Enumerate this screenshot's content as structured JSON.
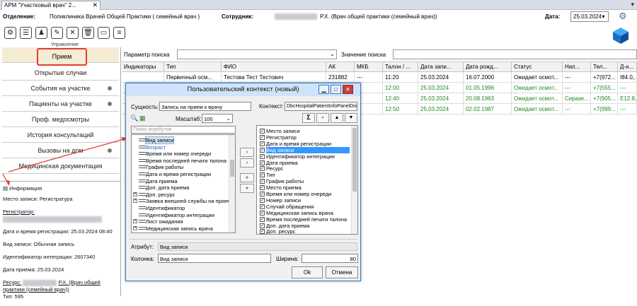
{
  "window": {
    "tab_title": "АРМ \"Участковый врач\" 2...",
    "tab_close": "✕",
    "tab_arrow": "▾"
  },
  "header": {
    "dept_label": "Отделение:",
    "dept_value": "Поликлиника Врачей Общей Практики ( семейный врач )",
    "employee_label": "Сотрудник:",
    "employee_value": "Р.Х. (Врач общей практики (семейный врач))",
    "date_label": "Дата:",
    "date_value": "25.03.2024"
  },
  "toolbar": {
    "section_label": "Управление",
    "icons": [
      "person-gear-icon",
      "document-gear-icon",
      "users-icon",
      "monitor-edit-icon",
      "calendar-delete-icon",
      "trash-icon",
      "archive-icon",
      "list-settings-icon"
    ]
  },
  "nav": {
    "items": [
      {
        "label": "Прием",
        "dot": false
      },
      {
        "label": "Открытые случаи",
        "dot": false
      },
      {
        "label": "События на участке",
        "dot": true
      },
      {
        "label": "Пациенты на участке",
        "dot": true
      },
      {
        "label": "Проф. медосмотры",
        "dot": false
      },
      {
        "label": "История консультаций",
        "dot": false
      },
      {
        "label": "Вызовы на дом",
        "dot": true
      },
      {
        "label": "Медицинская документация",
        "dot": false
      }
    ]
  },
  "info": {
    "title": "Информация",
    "place": "Место записи: Регистратура",
    "registrar_label": "Регистратор:",
    "reg_datetime": "Дата и время регистрации: 25.03.2024 08:40",
    "record_type": "Вид записи: Обычная запись",
    "integration_id": "Идентификатор интеграции: 2607340",
    "reception_date": "Дата приема: 25.03.2024",
    "resource_label": "Ресурс:",
    "resource_value": "Р.Х. (Врач общей практики (семейный врач))",
    "type": "Тип: 595"
  },
  "search": {
    "param_label": "Параметр поиска",
    "value_label": "Значение поиска"
  },
  "table": {
    "columns": [
      "Индикаторы",
      "Тип",
      "ФИО",
      "АК",
      "МКБ",
      "Талон / ...",
      "Дата запи...",
      "Дата рожд...",
      "Статус",
      "Нап...",
      "Тел...",
      "Д-н..."
    ],
    "rows": [
      {
        "type": "Первичный осм...",
        "fio": "Тестова Тест Тестович",
        "ak": "231882",
        "mkb": "---",
        "time": "11:20",
        "date": "25.03.2024",
        "birth": "16.07.2000",
        "status": "Ожидает осмот...",
        "nap": "---",
        "tel": "+7(972...",
        "dn": "I84.0,...",
        "green": false
      },
      {
        "type": "",
        "fio": "",
        "ak": "",
        "mkb": "",
        "time": "12:00",
        "date": "25.03.2024",
        "birth": "01.05.1996",
        "status": "Ожидает осмот...",
        "nap": "---",
        "tel": "+7(555...",
        "dn": "---",
        "green": true
      },
      {
        "type": "",
        "fio": "",
        "ak": "",
        "mkb": "",
        "time": "12:40",
        "date": "25.03.2024",
        "birth": "20.08.1963",
        "status": "Ожидает осмот...",
        "nap": "Сиразе...",
        "tel": "+7(905...",
        "dn": "E12.8,...",
        "green": true
      },
      {
        "type": "",
        "fio": "",
        "ak": "",
        "mkb": "",
        "time": "12:50",
        "date": "25.03.2024",
        "birth": "02.02.1987",
        "status": "Ожидает осмот...",
        "nap": "---",
        "tel": "+7(999...",
        "dn": "---",
        "green": true
      }
    ]
  },
  "dialog": {
    "title": "Пользовательский контекст (новый)",
    "entity_label": "Сущность:",
    "entity_value": "Запись на прием к врачу",
    "scale_label": "Масштаб:",
    "scale_value": "100",
    "attr_search_placeholder": "Поиск атрибутов",
    "context_label": "Контекст:",
    "context_value": "DbcHospitalPatientInfoPanelDistr",
    "tree": [
      {
        "label": "Вид записи",
        "expander": false,
        "selected": true
      },
      {
        "label": "Возраст",
        "expander": false,
        "selected": false,
        "blue": true
      },
      {
        "label": "Время или номер очереди",
        "expander": false
      },
      {
        "label": "Время последней печати талона",
        "expander": false
      },
      {
        "label": "График работы",
        "expander": false
      },
      {
        "label": "Дата и время регистрации",
        "expander": false
      },
      {
        "label": "Дата приема",
        "expander": false
      },
      {
        "label": "Доп. дата приема",
        "expander": false
      },
      {
        "label": "Доп. ресурс",
        "expander": true
      },
      {
        "label": "Заявка внешней службы на прием",
        "expander": true
      },
      {
        "label": "Идентификатор",
        "expander": false
      },
      {
        "label": "Идентификатор интеграции",
        "expander": false
      },
      {
        "label": "Лист ожидания",
        "expander": true
      },
      {
        "label": "Медицинская запись врача",
        "expander": true
      }
    ],
    "context_items": [
      "Место записи",
      "Регистратор",
      "Дата и время регистрации",
      "Вид записи",
      "Идентификатор интеграции",
      "Дата приема",
      "Ресурс",
      "Тип",
      "График работы",
      "Место приема",
      "Время или номер очереди",
      "Номер записи",
      "Случай обращения",
      "Медицинская запись врача",
      "Время последней печати талона",
      "Доп. дата приема",
      "Доп. ресурс"
    ],
    "selected_context_index": 3,
    "move_buttons": [
      "›",
      "‹",
      "»",
      "«"
    ],
    "ctx_buttons": [
      "Σ",
      "⸗",
      "▲",
      "▼"
    ],
    "attribute_label": "Атрибут:",
    "attribute_value": "Вид записи",
    "column_label": "Колонка:",
    "column_value": "Вид записи",
    "width_label": "Ширина:",
    "width_value": "80",
    "ok": "Ok",
    "cancel": "Отмена"
  }
}
